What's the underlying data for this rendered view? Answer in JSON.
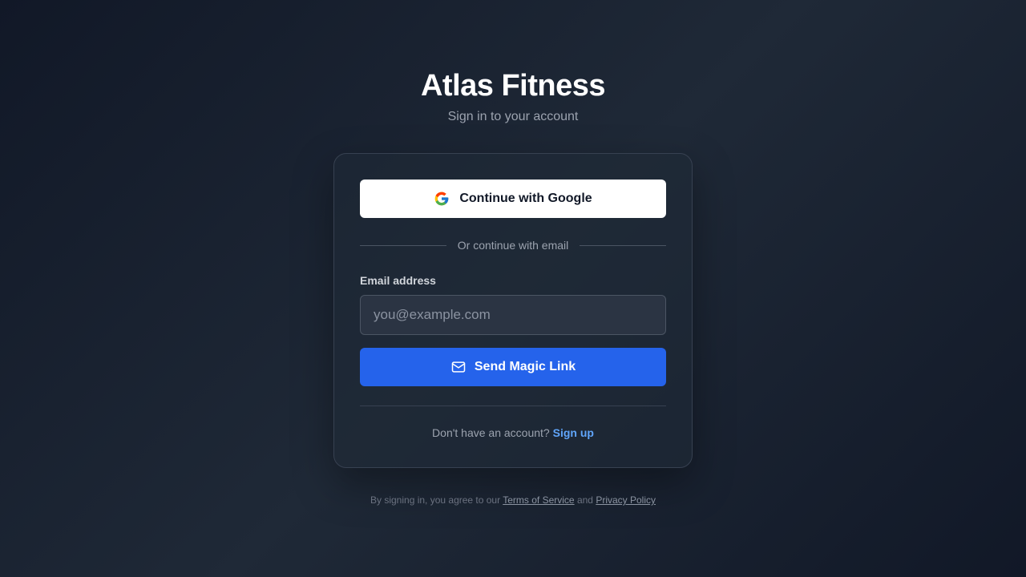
{
  "header": {
    "title": "Atlas Fitness",
    "subtitle": "Sign in to your account"
  },
  "google_button": {
    "label": "Continue with Google",
    "icon": "google-icon"
  },
  "divider": {
    "text": "Or continue with email"
  },
  "email_field": {
    "label": "Email address",
    "placeholder": "you@example.com",
    "value": ""
  },
  "magic_link_button": {
    "label": "Send Magic Link",
    "icon": "mail-icon"
  },
  "signup": {
    "prompt": "Don't have an account?",
    "link_label": "Sign up"
  },
  "legal": {
    "prefix": "By signing in, you agree to our",
    "terms_label": "Terms of Service",
    "conjunction": "and",
    "privacy_label": "Privacy Policy"
  },
  "colors": {
    "background": "#111827",
    "card_border": "#374151",
    "primary": "#2563eb",
    "link": "#60a5fa"
  }
}
